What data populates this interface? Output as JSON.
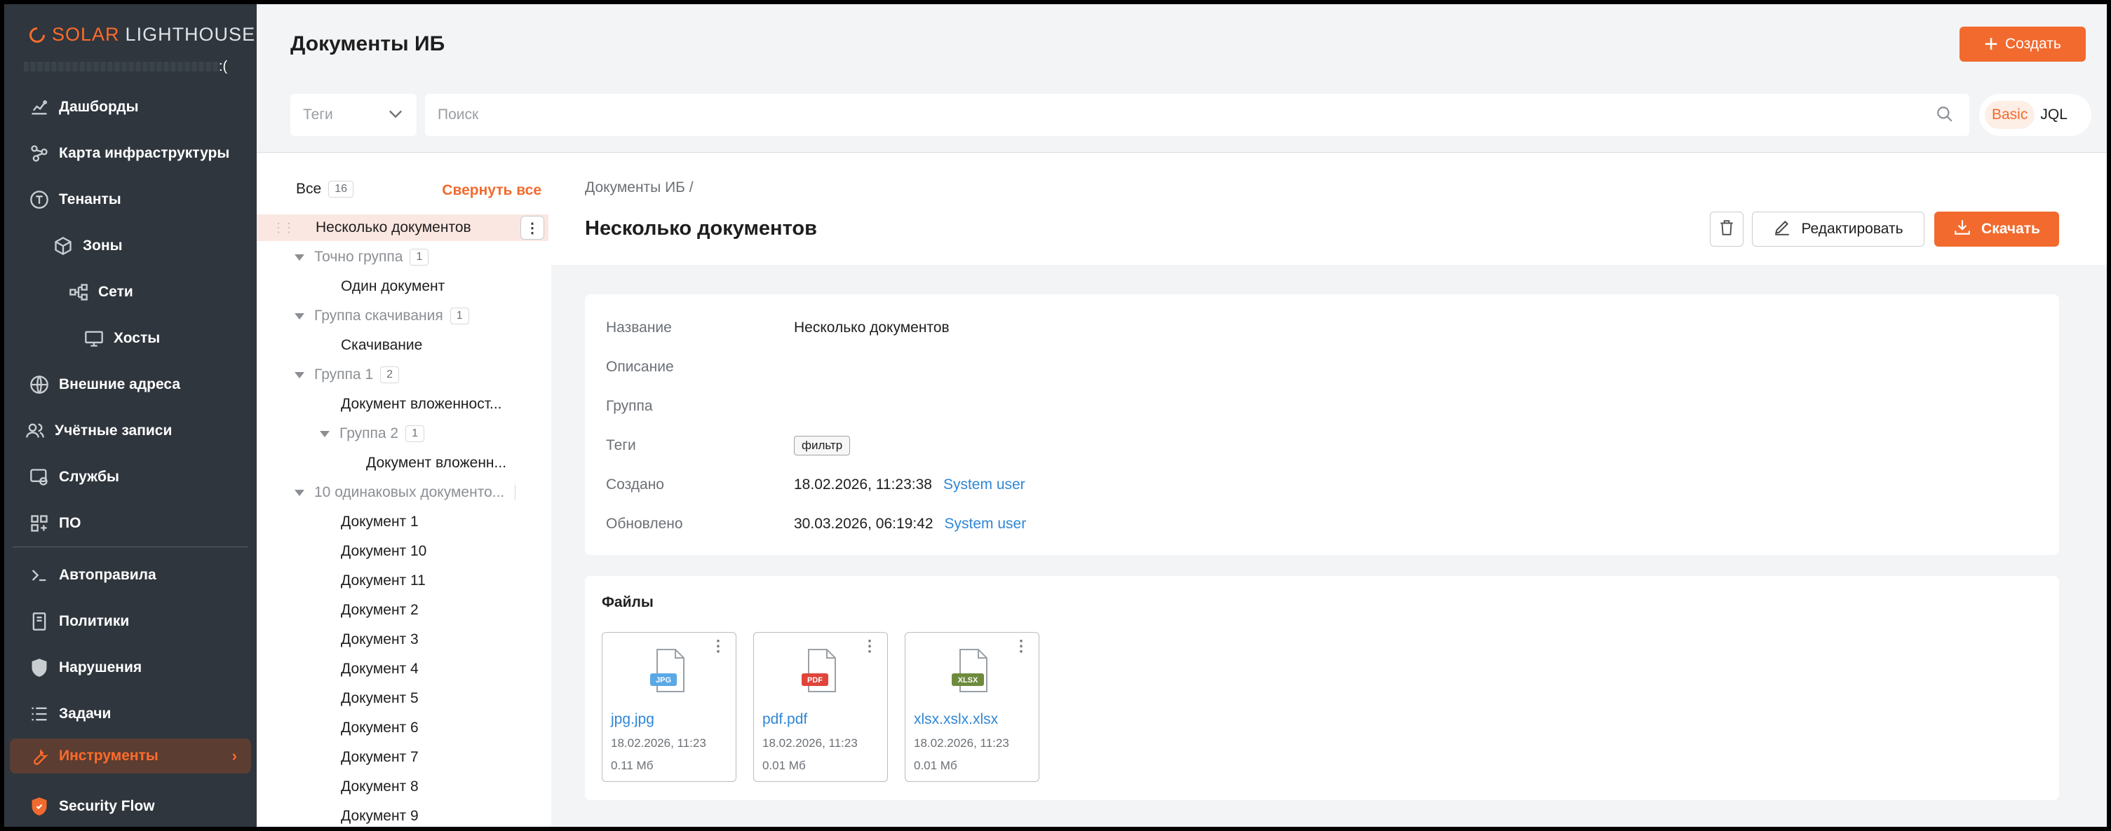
{
  "app": {
    "brand_solar": "SOLAR",
    "brand_rest": "LIGHTHOUSE",
    "user_mark": ":(",
    "accent": "#f26a2e"
  },
  "sidebar": {
    "items": [
      {
        "label": "Дашборды",
        "icon": "chart-icon"
      },
      {
        "label": "Карта инфраструктуры",
        "icon": "graph-icon"
      },
      {
        "label": "Тенанты",
        "icon": "tenant-icon"
      },
      {
        "label": "Зоны",
        "icon": "cube-icon"
      },
      {
        "label": "Сети",
        "icon": "network-icon"
      },
      {
        "label": "Хосты",
        "icon": "monitor-icon"
      },
      {
        "label": "Внешние адреса",
        "icon": "globe-icon"
      },
      {
        "label": "Учётные записи",
        "icon": "users-icon"
      },
      {
        "label": "Службы",
        "icon": "service-icon"
      },
      {
        "label": "ПО",
        "icon": "apps-icon"
      },
      {
        "label": "Автоправила",
        "icon": "terminal-icon"
      },
      {
        "label": "Политики",
        "icon": "document-icon"
      },
      {
        "label": "Нарушения",
        "icon": "shield-icon"
      },
      {
        "label": "Задачи",
        "icon": "tasks-icon"
      },
      {
        "label": "Инструменты",
        "icon": "wrench-icon"
      },
      {
        "label": "Security Flow",
        "icon": "security-flow-icon"
      }
    ],
    "chevron": "›"
  },
  "header": {
    "title": "Документы ИБ",
    "create_label": "Создать",
    "create_plus": "+",
    "tags_placeholder": "Теги",
    "search_placeholder": "Поиск",
    "mode_basic": "Basic",
    "mode_jql": "JQL"
  },
  "tree": {
    "all_label": "Все",
    "all_count": "16",
    "collapse_label": "Свернуть все",
    "kebab": "⋮",
    "grip": "⋮⋮",
    "rows": [
      {
        "label": "Несколько документов"
      },
      {
        "label": "Точно группа",
        "count": "1"
      },
      {
        "label": "Один документ"
      },
      {
        "label": "Группа скачивания",
        "count": "1"
      },
      {
        "label": "Скачивание"
      },
      {
        "label": "Группа 1",
        "count": "2"
      },
      {
        "label": "Документ вложенност..."
      },
      {
        "label": "Группа 2",
        "count": "1"
      },
      {
        "label": "Документ вложенн..."
      },
      {
        "label": "10 одинаковых документо..."
      },
      {
        "label": "Документ 1"
      },
      {
        "label": "Документ 10"
      },
      {
        "label": "Документ 11"
      },
      {
        "label": "Документ 2"
      },
      {
        "label": "Документ 3"
      },
      {
        "label": "Документ 4"
      },
      {
        "label": "Документ 5"
      },
      {
        "label": "Документ 6"
      },
      {
        "label": "Документ 7"
      },
      {
        "label": "Документ 8"
      },
      {
        "label": "Документ 9"
      }
    ]
  },
  "detail": {
    "breadcrumb": "Документы ИБ /",
    "title": "Несколько документов",
    "edit_label": "Редактировать",
    "download_label": "Скачать",
    "props": {
      "name_label": "Название",
      "name_value": "Несколько документов",
      "desc_label": "Описание",
      "group_label": "Группа",
      "tags_label": "Теги",
      "tag_value": "фильтр",
      "created_label": "Создано",
      "created_value": "18.02.2026, 11:23:38",
      "created_by": "System user",
      "updated_label": "Обновлено",
      "updated_value": "30.03.2026, 06:19:42",
      "updated_by": "System user"
    },
    "files_title": "Файлы",
    "files": [
      {
        "name": "jpg.jpg",
        "date": "18.02.2026, 11:23",
        "size": "0.11 Мб",
        "type": "JPG",
        "color": "#5aa9e6"
      },
      {
        "name": "pdf.pdf",
        "date": "18.02.2026, 11:23",
        "size": "0.01 Мб",
        "type": "PDF",
        "color": "#e0443a"
      },
      {
        "name": "xlsx.xslx.xlsx",
        "date": "18.02.2026, 11:23",
        "size": "0.01 Мб",
        "type": "XLSX",
        "color": "#6e8b3d"
      }
    ],
    "file_kebab": "⋮"
  }
}
